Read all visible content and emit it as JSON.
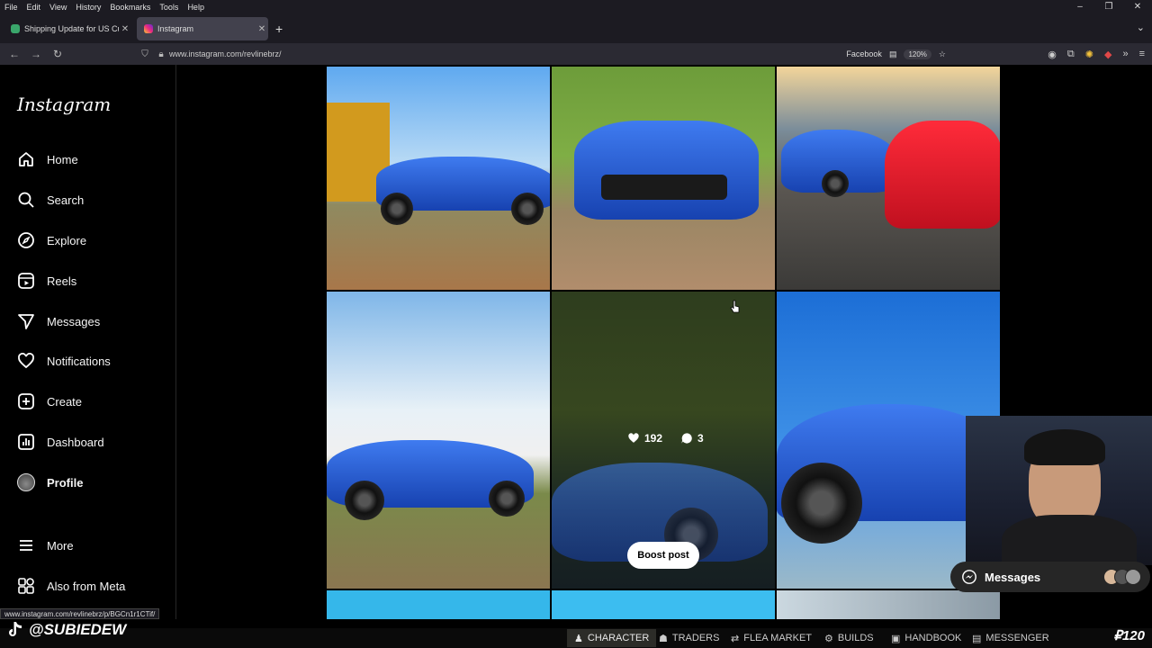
{
  "browser": {
    "menu": [
      "File",
      "Edit",
      "View",
      "History",
      "Bookmarks",
      "Tools",
      "Help"
    ],
    "tabs": [
      {
        "label": "Shipping Update for US Custom",
        "active": false
      },
      {
        "label": "Instagram",
        "active": true
      }
    ],
    "url": "www.instagram.com/revlinebrz/",
    "bookmark_label": "Facebook",
    "zoom": "120%",
    "status_url": "www.instagram.com/revlinebrz/p/BGCn1r1CTif/"
  },
  "sidebar": {
    "logo": "Instagram",
    "items": [
      {
        "label": "Home",
        "icon": "home-icon"
      },
      {
        "label": "Search",
        "icon": "search-icon"
      },
      {
        "label": "Explore",
        "icon": "compass-icon"
      },
      {
        "label": "Reels",
        "icon": "reels-icon"
      },
      {
        "label": "Messages",
        "icon": "messenger-icon"
      },
      {
        "label": "Notifications",
        "icon": "heart-icon"
      },
      {
        "label": "Create",
        "icon": "plus-square-icon"
      },
      {
        "label": "Dashboard",
        "icon": "chart-icon"
      },
      {
        "label": "Profile",
        "icon": "avatar-icon"
      },
      {
        "label": "More",
        "icon": "menu-icon"
      },
      {
        "label": "Also from Meta",
        "icon": "meta-apps-icon"
      }
    ]
  },
  "post_overlay": {
    "likes": "192",
    "comments": "3",
    "boost_label": "Boost post"
  },
  "messages_pill": {
    "label": "Messages"
  },
  "stream": {
    "tiktok_handle": "@SUBIEDEW",
    "game_tabs": [
      "CHARACTER",
      "TRADERS",
      "FLEA MARKET",
      "BUILDS",
      "HANDBOOK",
      "MESSENGER"
    ],
    "currency": "₽120"
  }
}
